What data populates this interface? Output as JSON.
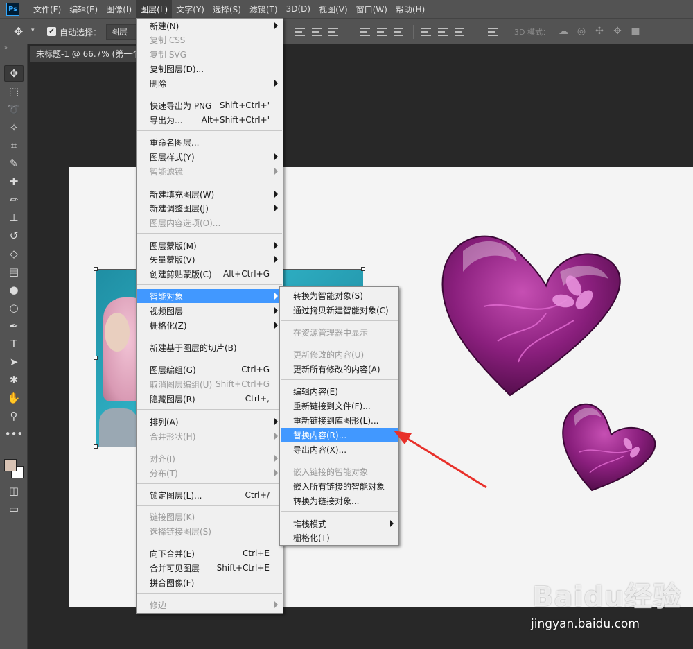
{
  "menubar": {
    "logo": "Ps",
    "items": [
      "文件(F)",
      "编辑(E)",
      "图像(I)",
      "图层(L)",
      "文字(Y)",
      "选择(S)",
      "滤镜(T)",
      "3D(D)",
      "视图(V)",
      "窗口(W)",
      "帮助(H)"
    ],
    "active_index": 3
  },
  "options_bar": {
    "auto_select_label": "自动选择：",
    "auto_select_checked": true,
    "auto_select_target": "图层",
    "mode_3d_label": "3D 模式："
  },
  "document": {
    "tab_title": "未标题-1 @ 66.7% (第一个"
  },
  "layer_menu": {
    "items": [
      {
        "label": "新建(N)",
        "shortcut": "",
        "submenu": true,
        "disabled": false
      },
      {
        "label": "复制 CSS",
        "shortcut": "",
        "submenu": false,
        "disabled": true
      },
      {
        "label": "复制 SVG",
        "shortcut": "",
        "submenu": false,
        "disabled": true
      },
      {
        "label": "复制图层(D)...",
        "shortcut": "",
        "submenu": false,
        "disabled": false
      },
      {
        "label": "删除",
        "shortcut": "",
        "submenu": true,
        "disabled": false
      },
      {
        "label": "快速导出为 PNG",
        "shortcut": "Shift+Ctrl+'",
        "submenu": false,
        "disabled": false
      },
      {
        "label": "导出为...",
        "shortcut": "Alt+Shift+Ctrl+'",
        "submenu": false,
        "disabled": false
      },
      {
        "label": "重命名图层...",
        "shortcut": "",
        "submenu": false,
        "disabled": false
      },
      {
        "label": "图层样式(Y)",
        "shortcut": "",
        "submenu": true,
        "disabled": false
      },
      {
        "label": "智能滤镜",
        "shortcut": "",
        "submenu": true,
        "disabled": true
      },
      {
        "label": "新建填充图层(W)",
        "shortcut": "",
        "submenu": true,
        "disabled": false
      },
      {
        "label": "新建调整图层(J)",
        "shortcut": "",
        "submenu": true,
        "disabled": false
      },
      {
        "label": "图层内容选项(O)...",
        "shortcut": "",
        "submenu": false,
        "disabled": true
      },
      {
        "label": "图层蒙版(M)",
        "shortcut": "",
        "submenu": true,
        "disabled": false
      },
      {
        "label": "矢量蒙版(V)",
        "shortcut": "",
        "submenu": true,
        "disabled": false
      },
      {
        "label": "创建剪贴蒙版(C)",
        "shortcut": "Alt+Ctrl+G",
        "submenu": false,
        "disabled": false
      },
      {
        "label": "智能对象",
        "shortcut": "",
        "submenu": true,
        "disabled": false,
        "highlighted": true
      },
      {
        "label": "视频图层",
        "shortcut": "",
        "submenu": true,
        "disabled": false
      },
      {
        "label": "栅格化(Z)",
        "shortcut": "",
        "submenu": true,
        "disabled": false
      },
      {
        "label": "新建基于图层的切片(B)",
        "shortcut": "",
        "submenu": false,
        "disabled": false
      },
      {
        "label": "图层编组(G)",
        "shortcut": "Ctrl+G",
        "submenu": false,
        "disabled": false
      },
      {
        "label": "取消图层编组(U)",
        "shortcut": "Shift+Ctrl+G",
        "submenu": false,
        "disabled": true
      },
      {
        "label": "隐藏图层(R)",
        "shortcut": "Ctrl+,",
        "submenu": false,
        "disabled": false
      },
      {
        "label": "排列(A)",
        "shortcut": "",
        "submenu": true,
        "disabled": false
      },
      {
        "label": "合并形状(H)",
        "shortcut": "",
        "submenu": true,
        "disabled": true
      },
      {
        "label": "对齐(I)",
        "shortcut": "",
        "submenu": true,
        "disabled": true
      },
      {
        "label": "分布(T)",
        "shortcut": "",
        "submenu": true,
        "disabled": true
      },
      {
        "label": "锁定图层(L)...",
        "shortcut": "Ctrl+/",
        "submenu": false,
        "disabled": false
      },
      {
        "label": "链接图层(K)",
        "shortcut": "",
        "submenu": false,
        "disabled": true
      },
      {
        "label": "选择链接图层(S)",
        "shortcut": "",
        "submenu": false,
        "disabled": true
      },
      {
        "label": "向下合并(E)",
        "shortcut": "Ctrl+E",
        "submenu": false,
        "disabled": false
      },
      {
        "label": "合并可见图层",
        "shortcut": "Shift+Ctrl+E",
        "submenu": false,
        "disabled": false
      },
      {
        "label": "拼合图像(F)",
        "shortcut": "",
        "submenu": false,
        "disabled": false
      },
      {
        "label": "修边",
        "shortcut": "",
        "submenu": true,
        "disabled": true
      }
    ]
  },
  "smart_object_menu": {
    "items": [
      {
        "label": "转换为智能对象(S)",
        "submenu": false,
        "disabled": false
      },
      {
        "label": "通过拷贝新建智能对象(C)",
        "submenu": false,
        "disabled": false
      },
      {
        "label": "在资源管理器中显示",
        "submenu": false,
        "disabled": true
      },
      {
        "label": "更新修改的内容(U)",
        "submenu": false,
        "disabled": true
      },
      {
        "label": "更新所有修改的内容(A)",
        "submenu": false,
        "disabled": false
      },
      {
        "label": "编辑内容(E)",
        "submenu": false,
        "disabled": false
      },
      {
        "label": "重新链接到文件(F)...",
        "submenu": false,
        "disabled": false
      },
      {
        "label": "重新链接到库图形(L)...",
        "submenu": false,
        "disabled": false
      },
      {
        "label": "替换内容(R)...",
        "submenu": false,
        "disabled": false,
        "highlighted": true
      },
      {
        "label": "导出内容(X)...",
        "submenu": false,
        "disabled": false
      },
      {
        "label": "嵌入链接的智能对象",
        "submenu": false,
        "disabled": true
      },
      {
        "label": "嵌入所有链接的智能对象",
        "submenu": false,
        "disabled": false
      },
      {
        "label": "转换为链接对象...",
        "submenu": false,
        "disabled": false
      },
      {
        "label": "堆栈模式",
        "submenu": true,
        "disabled": false
      },
      {
        "label": "栅格化(T)",
        "submenu": false,
        "disabled": false
      }
    ]
  },
  "watermark": {
    "logo": "Baidu经验",
    "url": "jingyan.baidu.com"
  },
  "colors": {
    "menu_highlight": "#4198ff",
    "canvas": "#f4f4f4",
    "heart": "#7a1a6e",
    "annotation_arrow": "#e8302a",
    "foreground_swatch": "#d8c3b4",
    "background_swatch": "#ffffff"
  },
  "tools": [
    "move-tool",
    "marquee-tool",
    "lasso-tool",
    "magic-wand-tool",
    "crop-tool",
    "eyedropper-tool",
    "healing-brush-tool",
    "brush-tool",
    "clone-stamp-tool",
    "history-brush-tool",
    "eraser-tool",
    "gradient-tool",
    "blur-tool",
    "dodge-tool",
    "pen-tool",
    "type-tool",
    "path-selection-tool",
    "shape-tool",
    "hand-tool",
    "zoom-tool",
    "more-tools"
  ]
}
